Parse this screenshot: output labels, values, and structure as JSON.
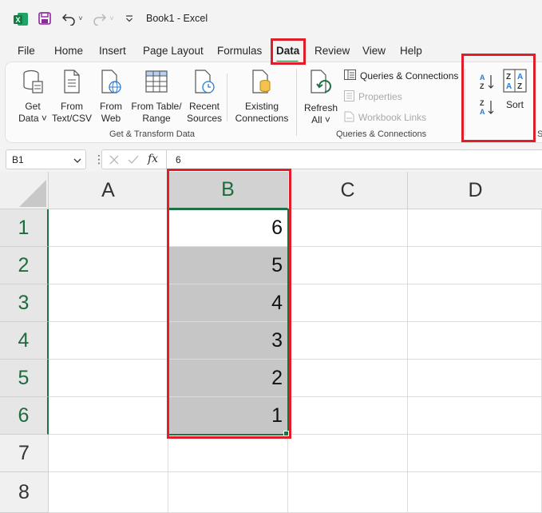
{
  "titlebar": {
    "title": "Book1  -  Excel",
    "icons": [
      "excel-logo-icon",
      "save-icon",
      "undo-icon",
      "redo-icon",
      "customize-qat-icon"
    ]
  },
  "menu": {
    "tabs": [
      "File",
      "Home",
      "Insert",
      "Page Layout",
      "Formulas",
      "Data",
      "Review",
      "View",
      "Help"
    ],
    "active": "Data"
  },
  "ribbon": {
    "get_transform": {
      "get_data": [
        "Get",
        "Data ˅"
      ],
      "from_text": [
        "From",
        "Text/CSV"
      ],
      "from_web": [
        "From",
        "Web"
      ],
      "from_table": [
        "From Table/",
        "Range"
      ],
      "recent_sources": [
        "Recent",
        "Sources"
      ],
      "existing_connections": [
        "Existing",
        "Connections"
      ],
      "label": "Get & Transform Data"
    },
    "queries": {
      "refresh": [
        "Refresh",
        "All ˅"
      ],
      "queries_connections": "Queries & Connections",
      "properties": "Properties",
      "workbook_links": "Workbook Links",
      "label": "Queries & Connections"
    },
    "sort_filter": {
      "sort_label": "Sort",
      "group_label_partial": "S"
    }
  },
  "formula_bar": {
    "name_box": "B1",
    "fx": "fx",
    "value": "6"
  },
  "grid": {
    "columns": [
      "A",
      "B",
      "C",
      "D"
    ],
    "rows": [
      "1",
      "2",
      "3",
      "4",
      "5",
      "6",
      "7",
      "8"
    ],
    "b_values": [
      "6",
      "5",
      "4",
      "3",
      "2",
      "1"
    ]
  },
  "colors": {
    "accent_green": "#1e7145",
    "highlight_red": "#e01e29",
    "selection_fill": "#c6c6c6"
  }
}
